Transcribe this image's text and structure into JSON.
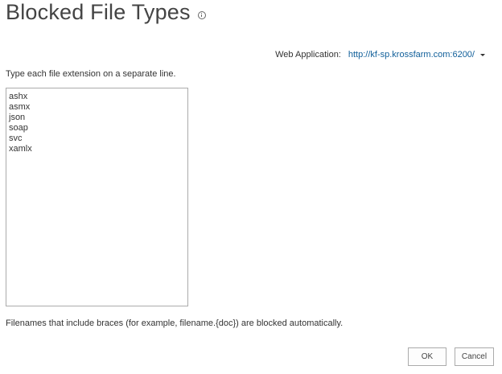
{
  "page": {
    "title": "Blocked File Types"
  },
  "web_application": {
    "label": "Web Application:",
    "url": "http://kf-sp.krossfarm.com:6200/"
  },
  "instruction": "Type each file extension on a separate line.",
  "extensions": "ashx\nasmx\njson\nsoap\nsvc\nxamlx",
  "footnote": "Filenames that include braces (for example, filename.{doc}) are blocked automatically.",
  "buttons": {
    "ok": "OK",
    "cancel": "Cancel"
  },
  "icons": {
    "title_info": "info-icon",
    "url_dropdown": "caret-down-icon"
  },
  "colors": {
    "link": "#0f5e99",
    "title": "#444444",
    "text": "#333333",
    "border": "#ababab"
  }
}
